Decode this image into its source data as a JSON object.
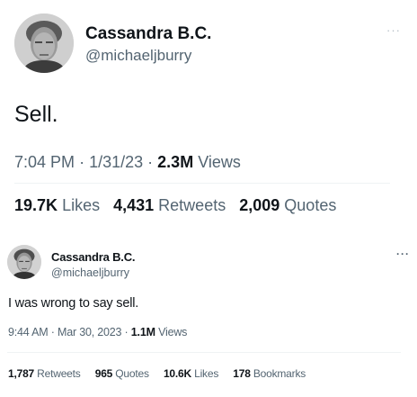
{
  "tweets": [
    {
      "author": {
        "display_name": "Cassandra B.C.",
        "handle": "@michaeljburry",
        "avatar_icon": "profile-photo"
      },
      "more_icon": "···",
      "text": "Sell.",
      "meta": {
        "time": "7:04 PM",
        "sep1": "·",
        "date": "1/31/23",
        "sep2": "·",
        "views_count": "2.3M",
        "views_label": "Views"
      },
      "stats": [
        {
          "count": "19.7K",
          "label": "Likes"
        },
        {
          "count": "4,431",
          "label": "Retweets"
        },
        {
          "count": "2,009",
          "label": "Quotes"
        }
      ]
    },
    {
      "author": {
        "display_name": "Cassandra B.C.",
        "handle": "@michaeljburry",
        "avatar_icon": "profile-photo"
      },
      "more_icon": "···",
      "text": "I was wrong to say sell.",
      "meta": {
        "time": "9:44 AM",
        "sep1": "·",
        "date": "Mar 30, 2023",
        "sep2": "·",
        "views_count": "1.1M",
        "views_label": "Views"
      },
      "stats": [
        {
          "count": "1,787",
          "label": "Retweets"
        },
        {
          "count": "965",
          "label": "Quotes"
        },
        {
          "count": "10.6K",
          "label": "Likes"
        },
        {
          "count": "178",
          "label": "Bookmarks"
        }
      ]
    }
  ],
  "colors": {
    "text_primary": "#0f1419",
    "text_secondary": "#536471",
    "divider": "#eff3f4",
    "background": "#ffffff"
  }
}
